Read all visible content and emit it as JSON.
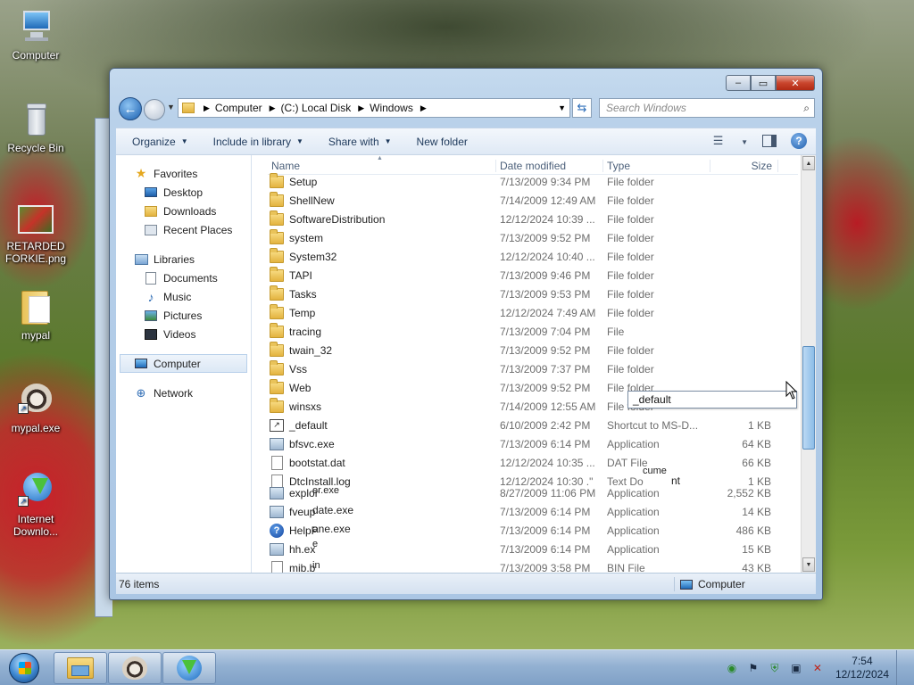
{
  "desktop": {
    "icons": [
      {
        "label": "Computer",
        "icon": "computer-icon"
      },
      {
        "label": "Recycle Bin",
        "icon": "recycle-bin-icon"
      },
      {
        "label": "RETARDED FORKIE.png",
        "icon": "image-file-icon"
      },
      {
        "label": "mypal",
        "icon": "folder-icon"
      },
      {
        "label": "mypal.exe",
        "icon": "raccoon-app-icon"
      },
      {
        "label": "Internet Downlo...",
        "icon": "download-manager-icon"
      }
    ]
  },
  "window": {
    "caption": {
      "minimize": "–",
      "maximize": "▭",
      "close": "✕"
    },
    "address": {
      "crumbs": [
        "Computer",
        "(C:) Local Disk",
        "Windows"
      ]
    },
    "search": {
      "placeholder": "Search Windows"
    },
    "toolbar": {
      "organize": "Organize",
      "include_in_library": "Include in library",
      "share_with": "Share with",
      "new_folder": "New folder"
    },
    "navpane": {
      "favorites": "Favorites",
      "desktop": "Desktop",
      "downloads": "Downloads",
      "recent_places": "Recent Places",
      "libraries": "Libraries",
      "documents": "Documents",
      "music": "Music",
      "pictures": "Pictures",
      "videos": "Videos",
      "computer": "Computer",
      "network": "Network"
    },
    "columns": {
      "name": "Name",
      "date": "Date modified",
      "type": "Type",
      "size": "Size"
    },
    "rows": [
      {
        "name": "Setup",
        "date": "7/13/2009 9:34 PM",
        "type": "File folder",
        "size": "",
        "icon": "folder"
      },
      {
        "name": "ShellNew",
        "date": "7/14/2009 12:49 AM",
        "type": "File folder",
        "size": "",
        "icon": "folder"
      },
      {
        "name": "SoftwareDistribution",
        "date": "12/12/2024 10:39 ...",
        "type": "File folder",
        "size": "",
        "icon": "folder"
      },
      {
        "name": "system",
        "date": "7/13/2009 9:52 PM",
        "type": "File folder",
        "size": "",
        "icon": "folder"
      },
      {
        "name": "System32",
        "date": "12/12/2024 10:40 ...",
        "type": "File folder",
        "size": "",
        "icon": "folder"
      },
      {
        "name": "TAPI",
        "date": "7/13/2009 9:46 PM",
        "type": "File folder",
        "size": "",
        "icon": "folder"
      },
      {
        "name": "Tasks",
        "date": "7/13/2009 9:53 PM",
        "type": "File folder",
        "size": "",
        "icon": "folder"
      },
      {
        "name": "Temp",
        "date": "12/12/2024 7:49 AM",
        "type": "File folder",
        "size": "",
        "icon": "folder"
      },
      {
        "name": "tracing",
        "date": "7/13/2009 7:04 PM",
        "type": "File",
        "size": "",
        "icon": "folder"
      },
      {
        "name": "twain_32",
        "date": "7/13/2009 9:52 PM",
        "type": "File folder",
        "size": "",
        "icon": "folder"
      },
      {
        "name": "Vss",
        "date": "7/13/2009 7:37 PM",
        "type": "File folder",
        "size": "",
        "icon": "folder"
      },
      {
        "name": "Web",
        "date": "7/13/2009 9:52 PM",
        "type": "File folder",
        "size": "",
        "icon": "folder"
      },
      {
        "name": "winsxs",
        "date": "7/14/2009 12:55 AM",
        "type": "File folder",
        "size": "",
        "icon": "folder"
      },
      {
        "name": "_default",
        "date": "6/10/2009 2:42 PM",
        "type": "Shortcut to MS-D...",
        "size": "1 KB",
        "icon": "shortcut"
      },
      {
        "name": "bfsvc.exe",
        "date": "7/13/2009 6:14 PM",
        "type": "Application",
        "size": "64 KB",
        "icon": "app"
      },
      {
        "name": "bootstat.dat",
        "date": "12/12/2024 10:35 ...",
        "type": "DAT File",
        "size": "66 KB",
        "icon": "doc"
      },
      {
        "name": "DtcInstall.log",
        "date": "12/12/2024 10:30 .\"",
        "type": "Text Do",
        "size": "1 KB",
        "icon": "doc"
      },
      {
        "name": "explor",
        "date": "8/27/2009 11:06 PM",
        "type": "Application",
        "size": "2,552 KB",
        "icon": "app"
      },
      {
        "name": "fveup",
        "date": "7/13/2009 6:14 PM",
        "type": "Application",
        "size": "14 KB",
        "icon": "app"
      },
      {
        "name": "HelpP",
        "date": "7/13/2009 6:14 PM",
        "type": "Application",
        "size": "486 KB",
        "icon": "help"
      },
      {
        "name": "hh.ex",
        "date": "7/13/2009 6:14 PM",
        "type": "Application",
        "size": "15 KB",
        "icon": "app"
      },
      {
        "name": "mib.b",
        "date": "7/13/2009 3:58 PM",
        "type": "BIN File",
        "size": "43 KB",
        "icon": "doc"
      }
    ],
    "rename_value": "_default",
    "garble": {
      "cume": "cume",
      "nt": "nt",
      "er_exe": "er.exe",
      "date_exe": "date.exe",
      "ane_exe": "ane.exe",
      "e": "e",
      "in": "in"
    },
    "status": {
      "items": "76 items",
      "location": "Computer"
    }
  },
  "taskbar": {
    "time": "7:54",
    "date": "12/12/2024"
  }
}
